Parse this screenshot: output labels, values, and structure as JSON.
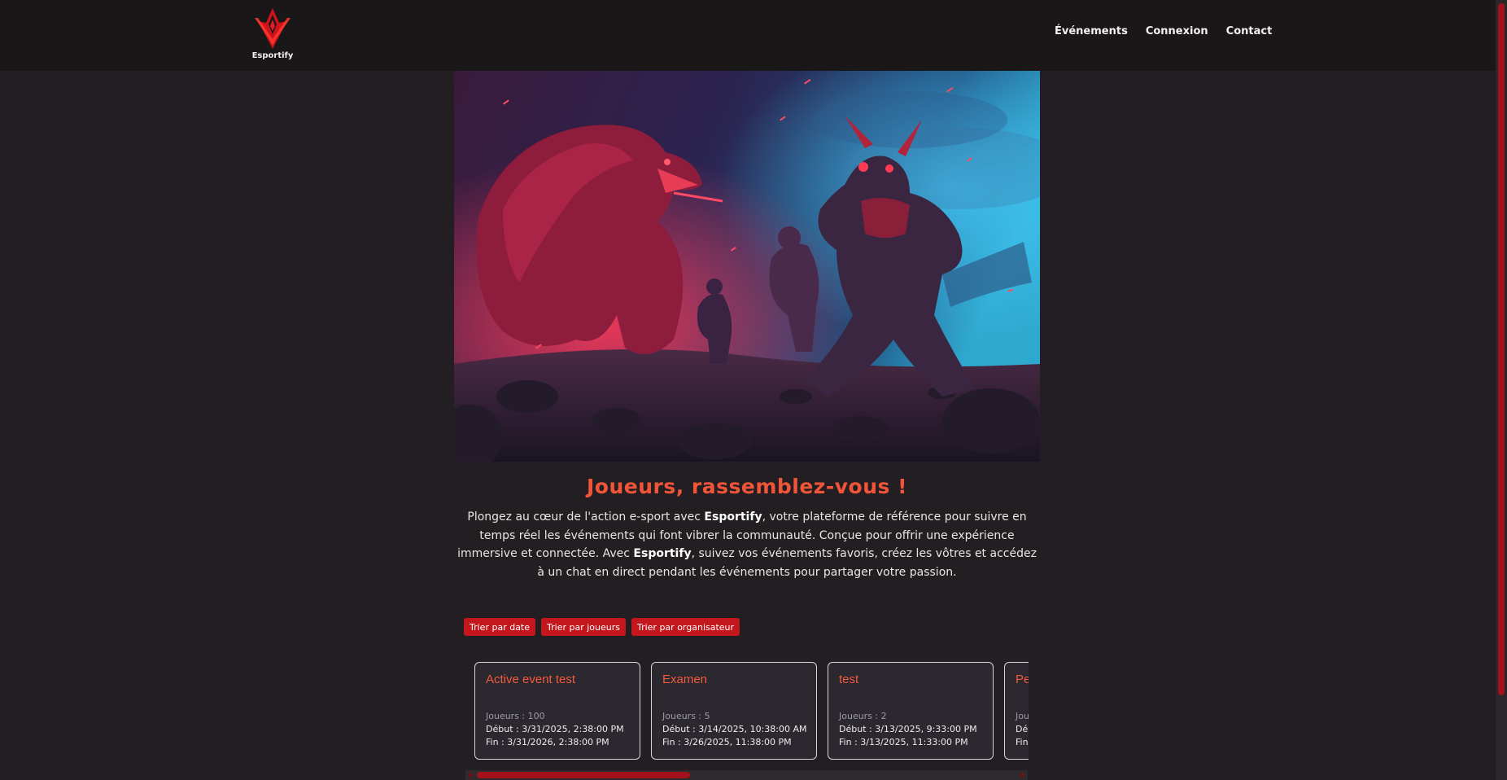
{
  "brand": {
    "name": "Esportify"
  },
  "nav": {
    "events": "Événements",
    "login": "Connexion",
    "contact": "Contact"
  },
  "hero": {
    "title": "Joueurs, rassemblez-vous !"
  },
  "intro": {
    "p1": "Plongez au cœur de l'action e-sport avec ",
    "b1": "Esportify",
    "p2": ", votre plateforme de référence pour suivre en temps réel les événements qui font vibrer la communauté. Conçue pour offrir une expérience immersive et connectée. Avec ",
    "b2": "Esportify",
    "p3": ", suivez vos événements favoris, créez les vôtres et accédez à un chat en direct pendant les événements pour partager votre passion."
  },
  "sort": {
    "by_date": "Trier par date",
    "by_players": "Trier par joueurs",
    "by_organizer": "Trier par organisateur"
  },
  "events": [
    {
      "title": "Active event test",
      "players": "Joueurs : 100",
      "start": "Début : 3/31/2025, 2:38:00 PM",
      "end": "Fin : 3/31/2026, 2:38:00 PM"
    },
    {
      "title": "Examen",
      "players": "Joueurs : 5",
      "start": "Début : 3/14/2025, 10:38:00 AM",
      "end": "Fin : 3/26/2025, 11:38:00 PM"
    },
    {
      "title": "test",
      "players": "Joueurs : 2",
      "start": "Début : 3/13/2025, 9:33:00 PM",
      "end": "Fin : 3/13/2025, 11:33:00 PM"
    },
    {
      "title": "Pe",
      "players": "Jou",
      "start": "Dé",
      "end": "Fin"
    }
  ],
  "colors": {
    "accent": "#f0553a",
    "button": "#c3171d",
    "scrollbar": "#a3121c",
    "background": "#221e21"
  }
}
